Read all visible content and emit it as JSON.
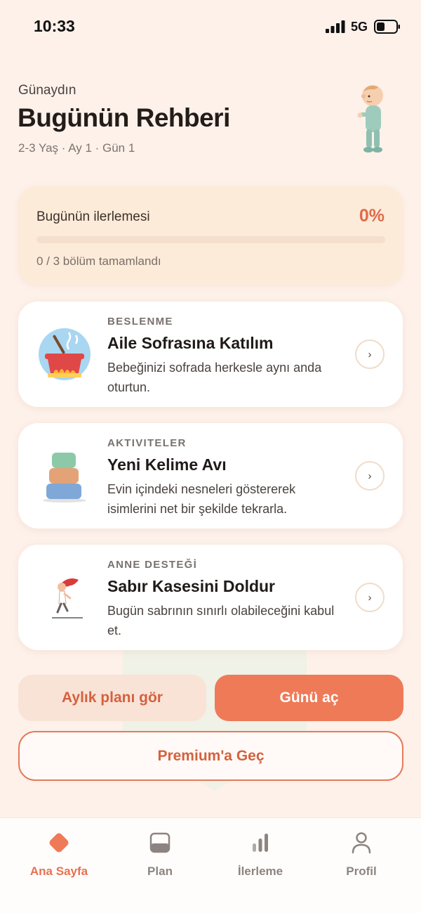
{
  "status_bar": {
    "time": "10:33",
    "network": "5G"
  },
  "header": {
    "greeting": "Günaydın",
    "title": "Bugünün Rehberi",
    "subtitle": "2-3 Yaş · Ay 1 · Gün 1",
    "avatar_icon": "toddler-illustration"
  },
  "progress": {
    "label": "Bugünün ilerlemesi",
    "percent_text": "0%",
    "percent_value": 0,
    "summary": "0 / 3 bölüm tamamlandı"
  },
  "tasks": [
    {
      "category": "BESLENME",
      "title": "Aile Sofrasına Katılım",
      "description": "Bebeğinizi sofrada herkesle aynı anda oturtun.",
      "icon": "cooking-pot-icon"
    },
    {
      "category": "AKTIVITELER",
      "title": "Yeni Kelime Avı",
      "description": "Evin içindeki nesneleri göstererek isimlerini net bir şekilde tekrarla.",
      "icon": "stacking-blocks-icon"
    },
    {
      "category": "ANNE DESTEĞİ",
      "title": "Sabır Kasesini Doldur",
      "description": "Bugün sabrının sınırlı olabileceğini kabul et.",
      "icon": "running-woman-icon"
    }
  ],
  "arrow_glyph": "›",
  "buttons": {
    "monthly_plan": "Aylık planı gör",
    "open_day": "Günü aç",
    "premium": "Premium'a Geç"
  },
  "nav": {
    "items": [
      {
        "label": "Ana Sayfa",
        "icon": "home-diamond-icon",
        "active": true
      },
      {
        "label": "Plan",
        "icon": "plan-icon",
        "active": false
      },
      {
        "label": "İlerleme",
        "icon": "bar-chart-icon",
        "active": false
      },
      {
        "label": "Profil",
        "icon": "person-icon",
        "active": false
      }
    ]
  },
  "colors": {
    "accent": "#ee7a58",
    "background": "#fdf1ea",
    "card": "#ffffff",
    "progress_card": "#fdebd9"
  }
}
